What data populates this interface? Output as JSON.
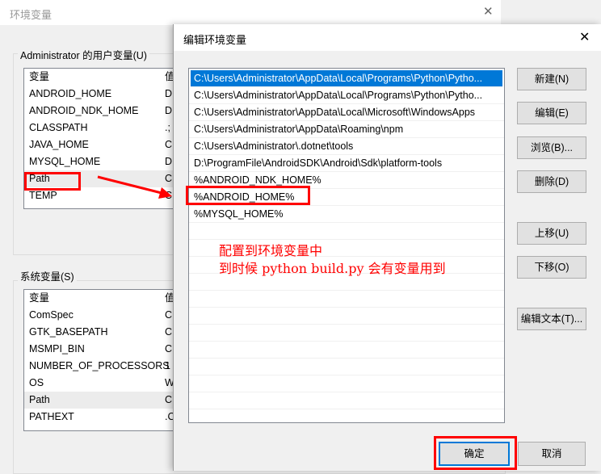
{
  "background_window": {
    "title": "环境变量",
    "user_group_label": "Administrator 的用户变量(U)",
    "columns": [
      "变量",
      "值"
    ],
    "user_vars": [
      {
        "name": "ANDROID_HOME",
        "value": "D"
      },
      {
        "name": "ANDROID_NDK_HOME",
        "value": "D"
      },
      {
        "name": "CLASSPATH",
        "value": ".;"
      },
      {
        "name": "JAVA_HOME",
        "value": "C"
      },
      {
        "name": "MYSQL_HOME",
        "value": "D"
      },
      {
        "name": "Path",
        "value": "C"
      },
      {
        "name": "TEMP",
        "value": "C"
      }
    ],
    "system_group_label": "系统变量(S)",
    "system_vars": [
      {
        "name": "ComSpec",
        "value": "C"
      },
      {
        "name": "GTK_BASEPATH",
        "value": "C"
      },
      {
        "name": "MSMPI_BIN",
        "value": "C"
      },
      {
        "name": "NUMBER_OF_PROCESSORS",
        "value": "1"
      },
      {
        "name": "OS",
        "value": "W"
      },
      {
        "name": "Path",
        "value": "C"
      },
      {
        "name": "PATHEXT",
        "value": ".C"
      }
    ]
  },
  "dialog": {
    "title": "编辑环境变量",
    "close": "✕",
    "paths": [
      "C:\\Users\\Administrator\\AppData\\Local\\Programs\\Python\\Pytho...",
      "C:\\Users\\Administrator\\AppData\\Local\\Programs\\Python\\Pytho...",
      "C:\\Users\\Administrator\\AppData\\Local\\Microsoft\\WindowsApps",
      "C:\\Users\\Administrator\\AppData\\Roaming\\npm",
      "C:\\Users\\Administrator\\.dotnet\\tools",
      "D:\\ProgramFile\\AndroidSDK\\Android\\Sdk\\platform-tools",
      "%ANDROID_NDK_HOME%",
      "%ANDROID_HOME%",
      "%MYSQL_HOME%"
    ],
    "buttons": {
      "new": "新建(N)",
      "edit": "编辑(E)",
      "browse": "浏览(B)...",
      "delete": "删除(D)",
      "up": "上移(U)",
      "down": "下移(O)",
      "edit_text": "编辑文本(T)...",
      "ok": "确定",
      "cancel": "取消"
    }
  },
  "annotation": {
    "line1": "配置到环境变量中",
    "line2": "到时候 python build.py 会有变量用到",
    "color": "#ff0000"
  }
}
